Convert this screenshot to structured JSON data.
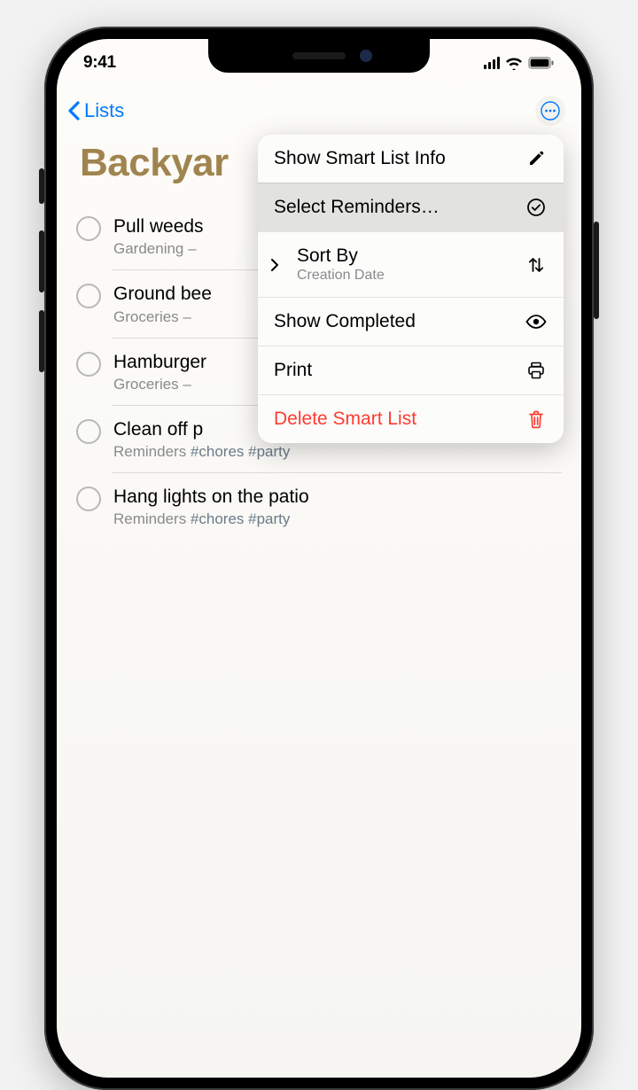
{
  "status": {
    "time": "9:41"
  },
  "nav": {
    "back_label": "Lists"
  },
  "page": {
    "title": "Backyar"
  },
  "reminders": [
    {
      "title": "Pull weeds",
      "sub_list": "Gardening –",
      "tags": ""
    },
    {
      "title": "Ground bee",
      "sub_list": "Groceries –",
      "tags": ""
    },
    {
      "title": "Hamburger",
      "sub_list": "Groceries –",
      "tags": ""
    },
    {
      "title": "Clean off p",
      "sub_list": "Reminders",
      "tags": "#chores #party"
    },
    {
      "title": "Hang lights on the patio",
      "sub_list": "Reminders",
      "tags": "#chores #party"
    }
  ],
  "menu": {
    "show_info": "Show Smart List Info",
    "select": "Select Reminders…",
    "sort_by": "Sort By",
    "sort_value": "Creation Date",
    "show_completed": "Show Completed",
    "print": "Print",
    "delete": "Delete Smart List"
  }
}
